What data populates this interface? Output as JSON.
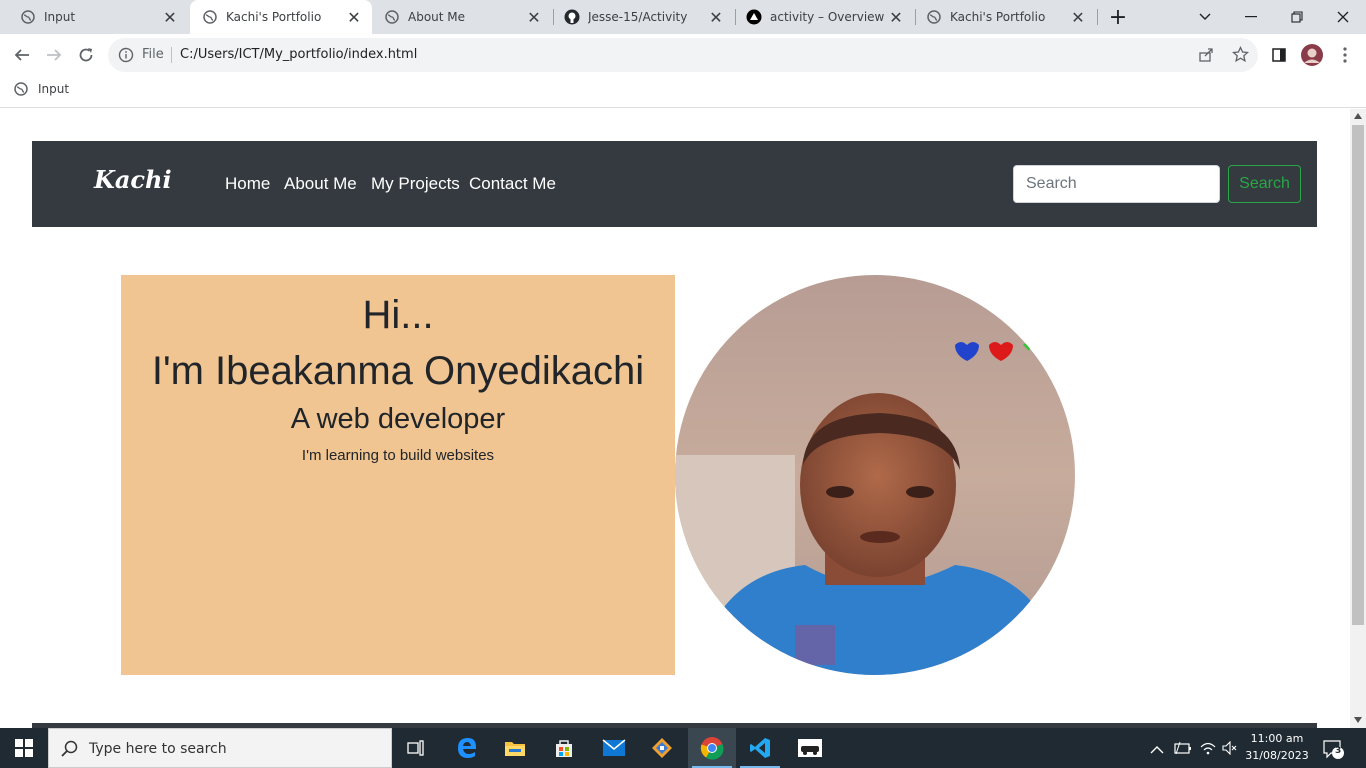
{
  "browser": {
    "tabs": [
      {
        "label": "Input",
        "active": false
      },
      {
        "label": "Kachi's Portfolio",
        "active": true
      },
      {
        "label": "About Me",
        "active": false
      },
      {
        "label": "Jesse-15/Activity",
        "active": false
      },
      {
        "label": "activity – Overview - V",
        "active": false
      },
      {
        "label": "Kachi's Portfolio",
        "active": false
      }
    ],
    "omnibox": {
      "scheme_label": "File",
      "url": "C:/Users/ICT/My_portfolio/index.html"
    },
    "bookmarks": [
      {
        "label": "Input"
      }
    ]
  },
  "page": {
    "navbar": {
      "brand": "Kachi",
      "links": [
        "Home",
        "About Me",
        "My Projects",
        "Contact Me"
      ],
      "search_placeholder": "Search",
      "search_button": "Search"
    },
    "hero": {
      "greeting": "Hi...",
      "name": "I'm Ibeakanma Onyedikachi",
      "role": "A web developer",
      "tagline": "I'm learning to build websites"
    }
  },
  "taskbar": {
    "search_placeholder": "Type here to search",
    "time": "11:00 am",
    "date": "31/08/2023",
    "notification_count": "3"
  },
  "colors": {
    "navbar_bg": "#343a40",
    "hero_bg": "#f0c591",
    "search_button": "#28a745",
    "tabstrip_bg": "#dee1e6"
  }
}
